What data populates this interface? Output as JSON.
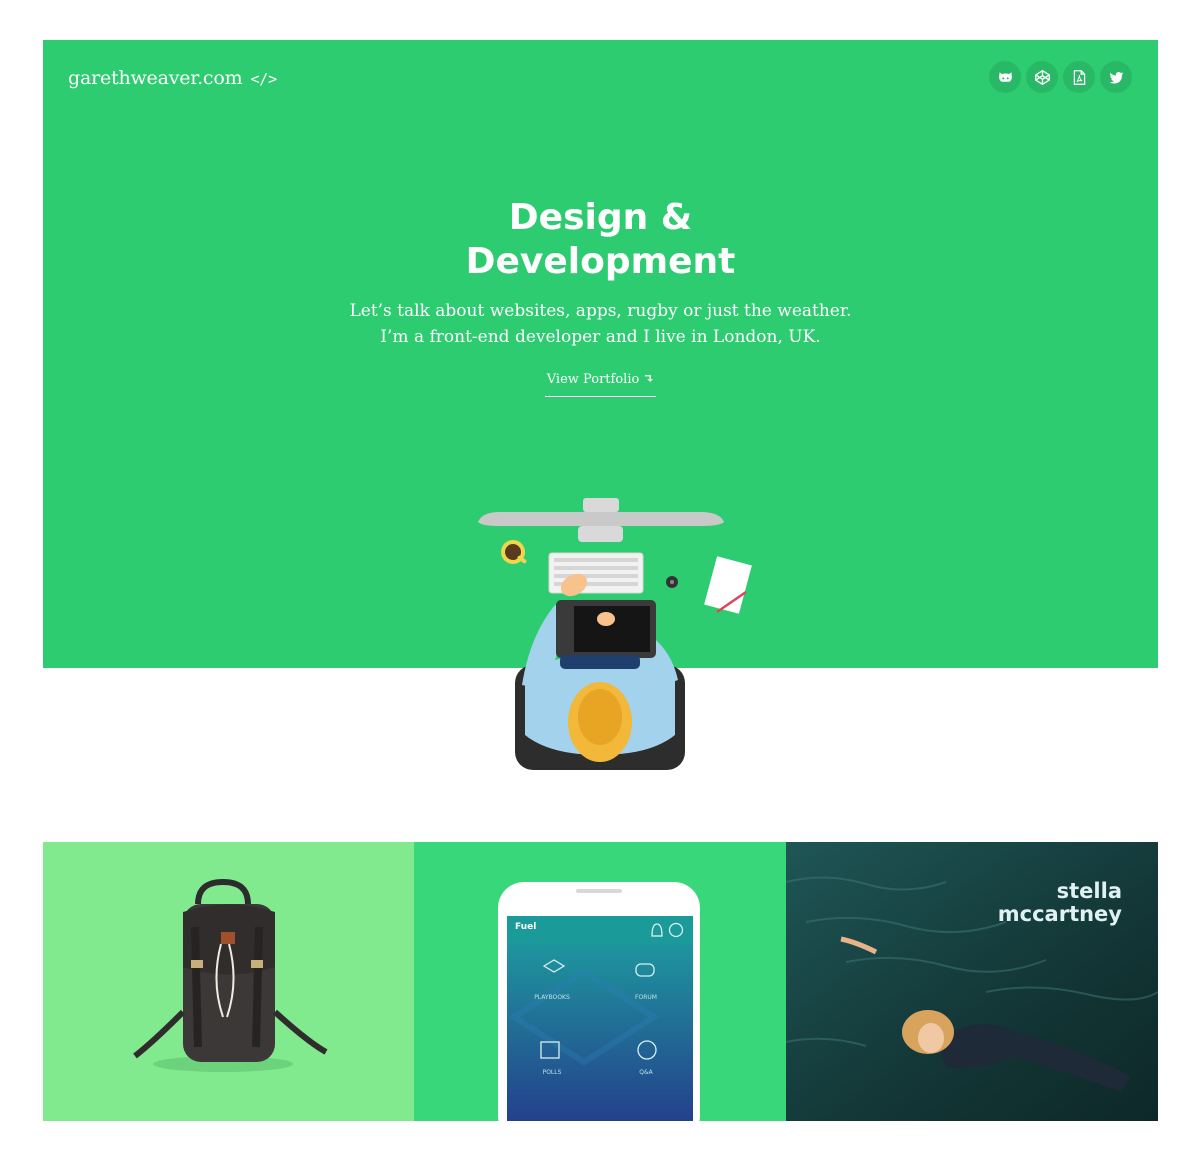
{
  "header": {
    "logo": "garethweaver.com",
    "logo_code": "</>",
    "social": [
      {
        "icon": "github-icon"
      },
      {
        "icon": "codepen-icon"
      },
      {
        "icon": "pdf-icon"
      },
      {
        "icon": "twitter-icon"
      }
    ]
  },
  "hero": {
    "headline_line1": "Design &",
    "headline_line2": "Development",
    "tagline_line1": "Let’s talk about websites, apps, rugby or just the weather.",
    "tagline_line2": "I’m a front-end developer and I live in London, UK.",
    "cta_label": "View Portfolio",
    "cta_arrow": "↴"
  },
  "portfolio": {
    "app": {
      "title": "Fuel",
      "items": [
        "PLAYBOOKS",
        "FORUM",
        "POLLS",
        "Q&A"
      ]
    },
    "stella": {
      "line1": "stella",
      "line2": "mccartney"
    }
  },
  "colors": {
    "hero_bg": "#2ecc71",
    "tile1_bg": "#81ea8f",
    "tile2_bg": "#38d87a",
    "text": "#ffffff"
  }
}
